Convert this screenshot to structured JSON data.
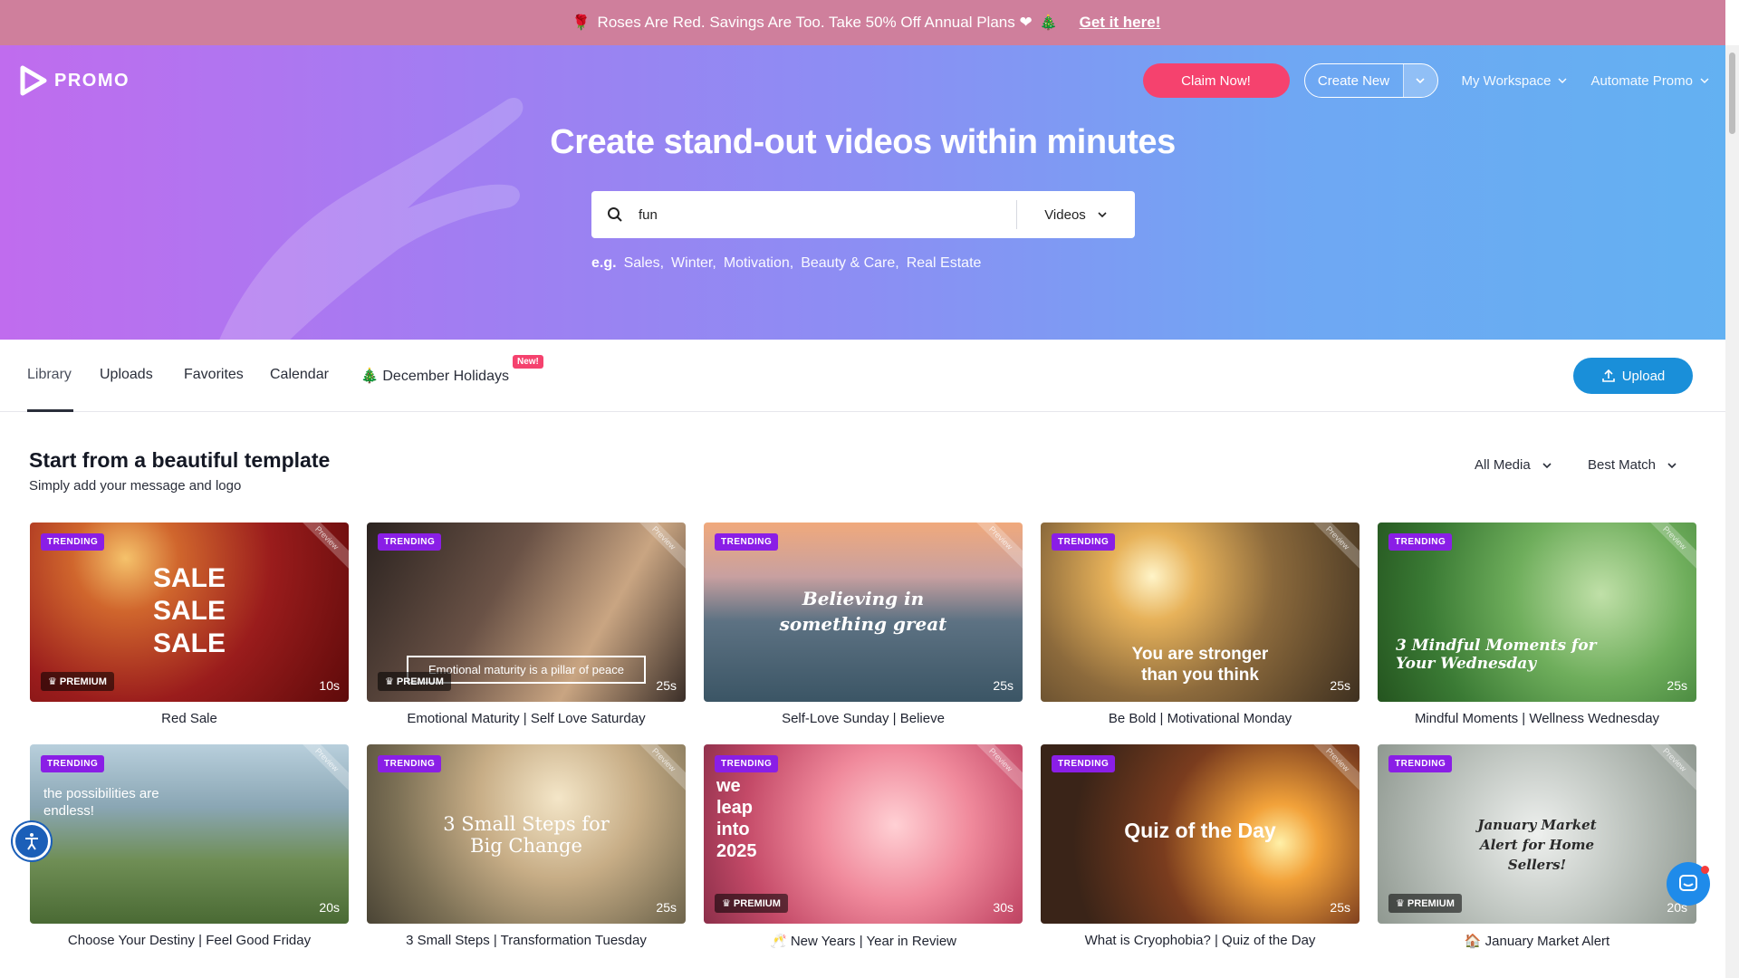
{
  "promo": {
    "emoji_left": "🌹",
    "text": "Roses Are Red. Savings Are Too. Take 50% Off Annual Plans ❤",
    "emoji_right": "🎄",
    "cta": "Get it here!"
  },
  "header": {
    "logo_text": "PROMO",
    "claim_label": "Claim Now!",
    "create_label": "Create New",
    "workspace_label": "My Workspace",
    "automate_label": "Automate Promo"
  },
  "hero": {
    "title": "Create stand-out videos within minutes",
    "search_value": "fun",
    "type_label": "Videos",
    "examples_prefix": "e.g.",
    "examples": [
      "Sales,",
      "Winter,",
      "Motivation,",
      "Beauty & Care,",
      "Real Estate"
    ]
  },
  "tabs": {
    "library": "Library",
    "uploads": "Uploads",
    "favorites": "Favorites",
    "calendar": "Calendar",
    "holidays": "🎄 December Holidays",
    "new_badge": "New!",
    "upload_label": "Upload"
  },
  "section": {
    "title": "Start from a beautiful template",
    "subtitle": "Simply add your message and logo",
    "media_filter": "All Media",
    "sort_filter": "Best Match"
  },
  "badges": {
    "trending": "TRENDING",
    "premium": "♛ PREMIUM",
    "preview": "Preview"
  },
  "cards": [
    {
      "title": "Red Sale",
      "duration": "10s",
      "premium": true,
      "overlay": "SALE SALE SALE"
    },
    {
      "title": "Emotional Maturity | Self Love Saturday",
      "duration": "25s",
      "premium": true,
      "overlay": "Emotional maturity is a pillar of peace"
    },
    {
      "title": "Self-Love Sunday | Believe",
      "duration": "25s",
      "premium": false,
      "overlay": "Believing in something great"
    },
    {
      "title": "Be Bold | Motivational Monday",
      "duration": "25s",
      "premium": false,
      "overlay": "You are stronger than you think"
    },
    {
      "title": "Mindful Moments | Wellness Wednesday",
      "duration": "25s",
      "premium": false,
      "overlay": "3 Mindful Moments for Your Wednesday"
    },
    {
      "title": "Choose Your Destiny | Feel Good Friday",
      "duration": "20s",
      "premium": false,
      "overlay": "the possibilities are endless!"
    },
    {
      "title": "3 Small Steps | Transformation Tuesday",
      "duration": "25s",
      "premium": false,
      "overlay": "3 Small Steps for Big Change"
    },
    {
      "title": "🥂 New Years | Year in Review",
      "duration": "30s",
      "premium": true,
      "overlay": "we leap into 2025"
    },
    {
      "title": "What is Cryophobia? | Quiz of the Day",
      "duration": "25s",
      "premium": false,
      "overlay": "Quiz of the Day"
    },
    {
      "title": "🏠 January Market Alert",
      "duration": "20s",
      "premium": true,
      "overlay": "January Market Alert for Home Sellers!"
    }
  ],
  "colors": {
    "accent_pink": "#f5426e",
    "accent_blue": "#1a8fd9",
    "trending_purple": "#8a1ee6"
  }
}
